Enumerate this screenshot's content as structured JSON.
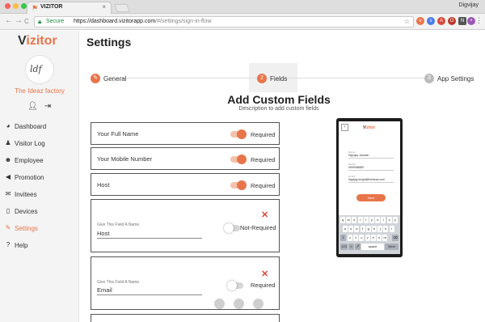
{
  "browser": {
    "tab_title": "VIZITOR",
    "tab_close": "×",
    "profile_name": "Digvijay",
    "secure_label": "Secure",
    "url_host": "https://dashboard.vizitorapp.com",
    "url_path": "/#/settings/sign-in-flow",
    "nav_back": "←",
    "nav_forward": "→",
    "nav_reload": "C",
    "menu": "⋮"
  },
  "sidebar": {
    "brand_v": "V",
    "brand_rest": "izitor",
    "logo_text": "ldf",
    "org_name": "The Ideaz factory",
    "items": [
      {
        "label": "Dashboard",
        "icon": "◕"
      },
      {
        "label": "Visitor Log",
        "icon": "♟"
      },
      {
        "label": "Employee",
        "icon": "☻"
      },
      {
        "label": "Promotion",
        "icon": "◀"
      },
      {
        "label": "Invitees",
        "icon": "✉"
      },
      {
        "label": "Devices",
        "icon": "▯"
      },
      {
        "label": "Settings",
        "icon": "✎"
      },
      {
        "label": "Help",
        "icon": "?"
      }
    ],
    "active_item": "Settings"
  },
  "main": {
    "page_title": "Settings",
    "steps": [
      {
        "number": "✎",
        "label": "General"
      },
      {
        "number": "2",
        "label": "Fields"
      },
      {
        "number": "3",
        "label": "App Settings"
      }
    ],
    "section_title": "Add Custom Fields",
    "section_subtitle": "Description to add custom fields",
    "fixed_fields": [
      {
        "label": "Your Full Name",
        "status": "Required",
        "enabled": true
      },
      {
        "label": "Your Mobile Number",
        "status": "Required",
        "enabled": true
      },
      {
        "label": "Host",
        "status": "Required",
        "enabled": true
      }
    ],
    "custom_fields": [
      {
        "caption": "Give This Field A Name",
        "value": "Host",
        "status": "Not-Required",
        "enabled": false,
        "remove": "✕"
      },
      {
        "caption": "Give This Field A Name",
        "value": "Email",
        "status": "Required",
        "enabled": false,
        "remove": "✕"
      }
    ]
  },
  "preview": {
    "brand_v": "V",
    "brand_rest": "izitor",
    "fields": [
      {
        "caption": "Name*",
        "value": "Digvijay Jamwal"
      },
      {
        "caption": "Mobile*",
        "value": "9999988887"
      },
      {
        "caption": "Email*",
        "value": "digvijay.singh@theideaz.com"
      }
    ],
    "next_label": "Next",
    "keyboard_rows": [
      [
        "q",
        "w",
        "e",
        "r",
        "t",
        "y",
        "u",
        "i",
        "o",
        "p"
      ],
      [
        "a",
        "s",
        "d",
        "f",
        "g",
        "h",
        "j",
        "k",
        "l"
      ],
      [
        "z",
        "x",
        "c",
        "v",
        "b",
        "n",
        "m"
      ]
    ],
    "space_label": "space",
    "next_key_label": "Next"
  },
  "colors": {
    "accent": "#e8754a",
    "danger": "#d9473b",
    "secure": "#1c8a3b"
  }
}
